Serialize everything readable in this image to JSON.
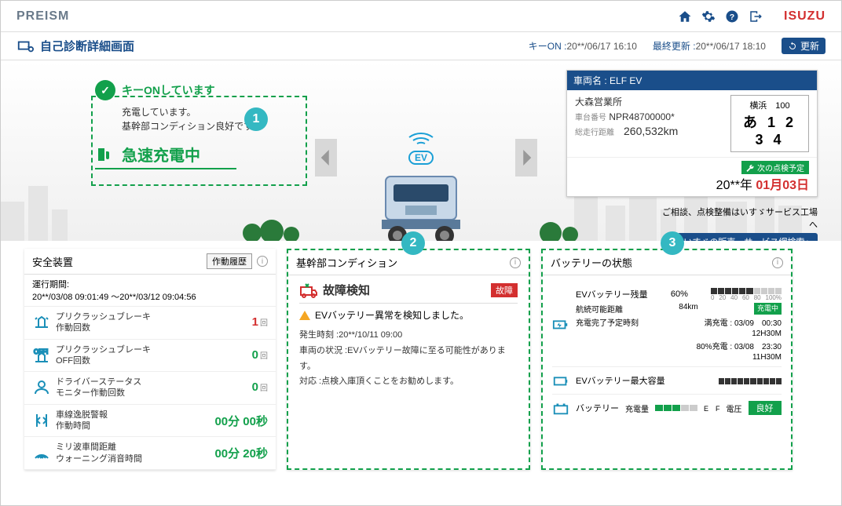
{
  "brand": {
    "preism": "PREISM",
    "isuzu": "ISUZU"
  },
  "page_title": "自己診断詳細画面",
  "times": {
    "key_on_label": "キーON :",
    "key_on_value": "20**/06/17 16:10",
    "updated_label": "最終更新 :",
    "updated_value": "20**/06/17 18:10",
    "refresh": "更新"
  },
  "status": {
    "key_on": "キーONしています",
    "line1": "充電しています。",
    "line2": "基幹部コンディション良好です。",
    "charge_state": "急速充電中"
  },
  "vehicle": {
    "name_label": "車両名 :",
    "name": "ELF EV",
    "office": "大森営業所",
    "chassis_label": "車台番号",
    "chassis": "NPR48700000*",
    "odo_label": "総走行距離",
    "odo": "260,532km",
    "plate_top": "横浜　100",
    "plate_num": "あ 1 2 3 4",
    "sched_label": "次の点検予定",
    "sched_year": "20**年",
    "sched_md": "01月03日"
  },
  "consult": {
    "text": "ご相談、点検整備はいすゞサービス工場へ",
    "btn": "いすゞの販売・サービス網検索"
  },
  "safety": {
    "title": "安全装置",
    "hist_btn": "作動履歴",
    "period_label": "運行期間:",
    "period": "20**/03/08 09:01:49 ～20**/03/12 09:04:56",
    "rows": [
      {
        "t1": "プリクラッシュブレーキ",
        "t2": "作動回数",
        "v": "1",
        "u": "回",
        "red": true
      },
      {
        "t1": "プリクラッシュブレーキ",
        "t2": "OFF回数",
        "v": "0",
        "u": "回"
      },
      {
        "t1": "ドライバーステータス",
        "t2": "モニター作動回数",
        "v": "0",
        "u": "回"
      },
      {
        "t1": "車線逸脱警報",
        "t2": "作動時間",
        "v": "00分 00秒"
      },
      {
        "t1": "ミリ波車間距離",
        "t2": "ウォーニング消音時間",
        "v": "00分 20秒"
      }
    ]
  },
  "condition": {
    "title": "基幹部コンディション",
    "detect": "故障検知",
    "badge": "故障",
    "warn": "EVバッテリー異常を検知しました。",
    "time_label": "発生時刻 :",
    "time": "20**/10/11 09:00",
    "state_label": "車両の状況 :",
    "state": "EVバッテリー故障に至る可能性があります。",
    "action_label": "対応 :",
    "action": "点検入庫頂くことをお勧めします。"
  },
  "battery": {
    "title": "バッテリーの状態",
    "ev_label": "EVバッテリー残量",
    "ev_pct": "60%",
    "range_label": "航続可能距離",
    "range": "84km",
    "charging": "充電中",
    "eta_label": "充電完了予定時刻",
    "full_label": "満充電",
    "full_time": "03/09　00:30",
    "full_dur": "12H30M",
    "p80_label": "80%充電",
    "p80_time": "03/08　23:30",
    "p80_dur": "11H30M",
    "cap_label": "EVバッテリー最大容量",
    "aux_label": "バッテリー",
    "aux_charge_label": "充電量",
    "aux_volt_label": "電圧",
    "aux_status": "良好"
  },
  "callouts": [
    "1",
    "2",
    "3"
  ]
}
